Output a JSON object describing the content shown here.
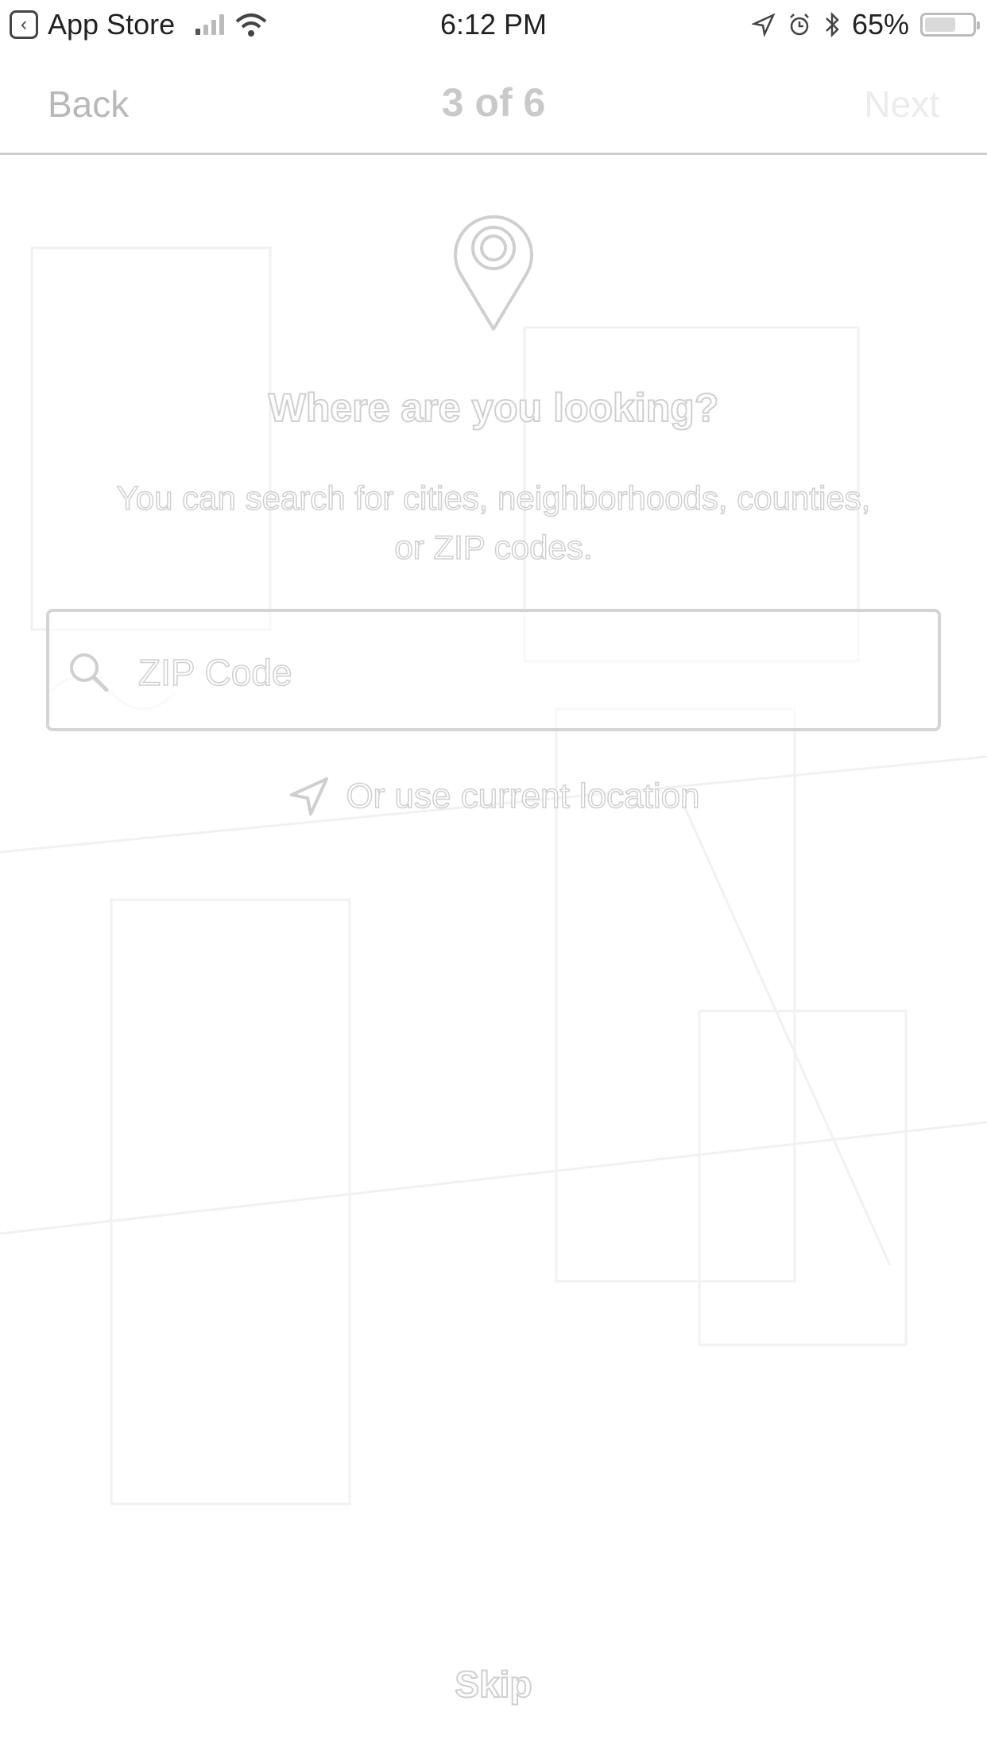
{
  "status_bar": {
    "back_app": "App Store",
    "time": "6:12 PM",
    "battery_percent": "65%",
    "battery_level": 0.65,
    "icons": [
      "back-app-icon",
      "signal-icon",
      "wifi-icon",
      "location-arrow-icon",
      "alarm-icon",
      "bluetooth-icon",
      "battery-icon"
    ]
  },
  "nav": {
    "back_label": "Back",
    "title": "3 of 6",
    "next_label": "Next"
  },
  "main": {
    "icon": "map-pin-icon",
    "headline": "Where are you looking?",
    "subtext": "You can search for cities, neighborhoods, counties, or ZIP codes.",
    "search": {
      "icon": "search-icon",
      "placeholder": "ZIP Code",
      "value": ""
    },
    "location_link": {
      "icon": "location-arrow-icon",
      "label": "Or use current location"
    }
  },
  "footer": {
    "skip_label": "Skip"
  },
  "colors": {
    "background": "#ffffff",
    "outline_text": "#cfcfcf",
    "divider": "#cfcfcf"
  }
}
